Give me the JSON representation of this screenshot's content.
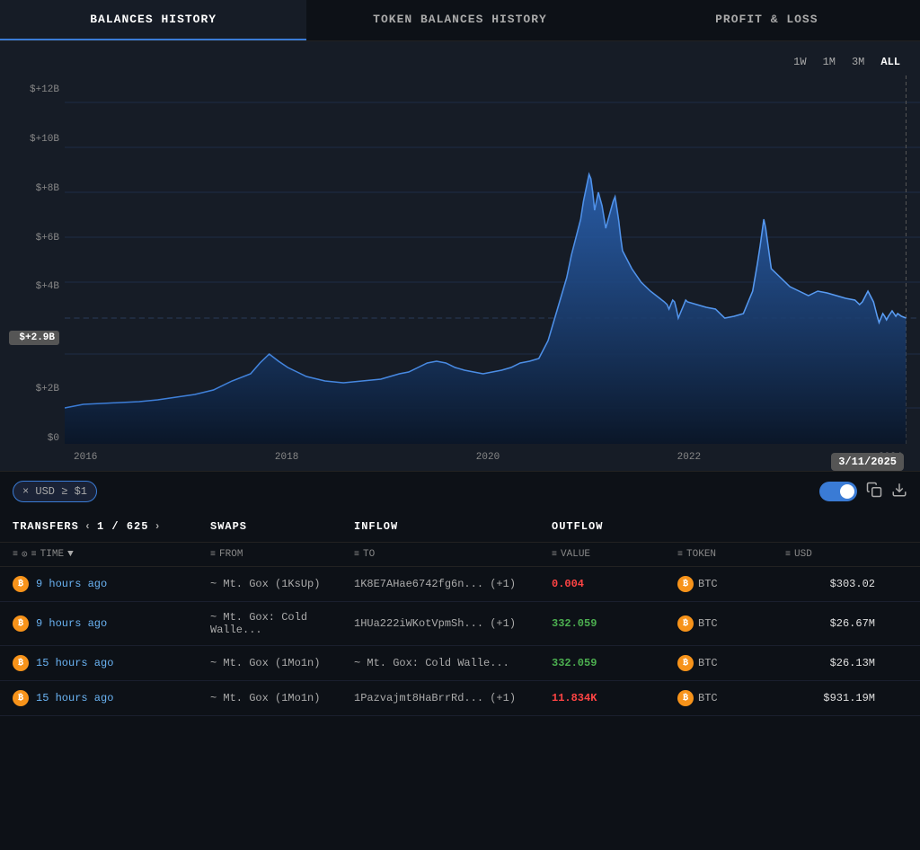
{
  "tabs": [
    {
      "id": "balances",
      "label": "BALANCES HISTORY",
      "active": true
    },
    {
      "id": "token",
      "label": "TOKEN BALANCES HISTORY",
      "active": false
    },
    {
      "id": "pnl",
      "label": "PROFIT & LOSS",
      "active": false
    }
  ],
  "chart": {
    "time_filters": [
      "1W",
      "1M",
      "3M",
      "ALL"
    ],
    "active_filter": "ALL",
    "y_axis": [
      "$+12B",
      "$+10B",
      "$+8B",
      "$+6B",
      "$+4B",
      "$+2.9B",
      "$+2B",
      "$0"
    ],
    "x_axis": [
      "2016",
      "2018",
      "2020",
      "2022",
      "2024"
    ],
    "tooltip_date": "3/11/2025",
    "highlight_value": "$+2.9B"
  },
  "filter": {
    "chip_label": "× USD ≥ $1"
  },
  "table": {
    "columns": {
      "transfers": "TRANSFERS",
      "page": "1 / 625",
      "swaps": "SWAPS",
      "inflow": "INFLOW",
      "outflow": "OUTFLOW"
    },
    "col_filters": [
      {
        "icon": "≡",
        "clock": "⊙",
        "label": "TIME",
        "sort": "▼"
      },
      {
        "icon": "≡",
        "label": "FROM"
      },
      {
        "icon": "≡",
        "label": "TO"
      },
      {
        "icon": "≡",
        "label": "VALUE"
      },
      {
        "icon": "≡",
        "label": "TOKEN"
      },
      {
        "icon": "≡",
        "label": "USD"
      }
    ],
    "rows": [
      {
        "time": "9 hours ago",
        "from": "~ Mt. Gox (1KsUp)",
        "to": "1K8E7AHae6742fg6n... (+1)",
        "value": "0.004",
        "value_color": "neg",
        "token": "BTC",
        "usd": "$303.02"
      },
      {
        "time": "9 hours ago",
        "from": "~ Mt. Gox: Cold Walle...",
        "to": "1HUa222iWKotVpmSh... (+1)",
        "value": "332.059",
        "value_color": "pos",
        "token": "BTC",
        "usd": "$26.67M"
      },
      {
        "time": "15 hours ago",
        "from": "~ Mt. Gox (1Mo1n)",
        "to": "~ Mt. Gox: Cold Walle...",
        "value": "332.059",
        "value_color": "pos",
        "token": "BTC",
        "usd": "$26.13M"
      },
      {
        "time": "15 hours ago",
        "from": "~ Mt. Gox (1Mo1n)",
        "to": "1Pazvajmt8HaBrrRd... (+1)",
        "value": "11.834K",
        "value_color": "neg",
        "token": "BTC",
        "usd": "$931.19M"
      }
    ]
  }
}
